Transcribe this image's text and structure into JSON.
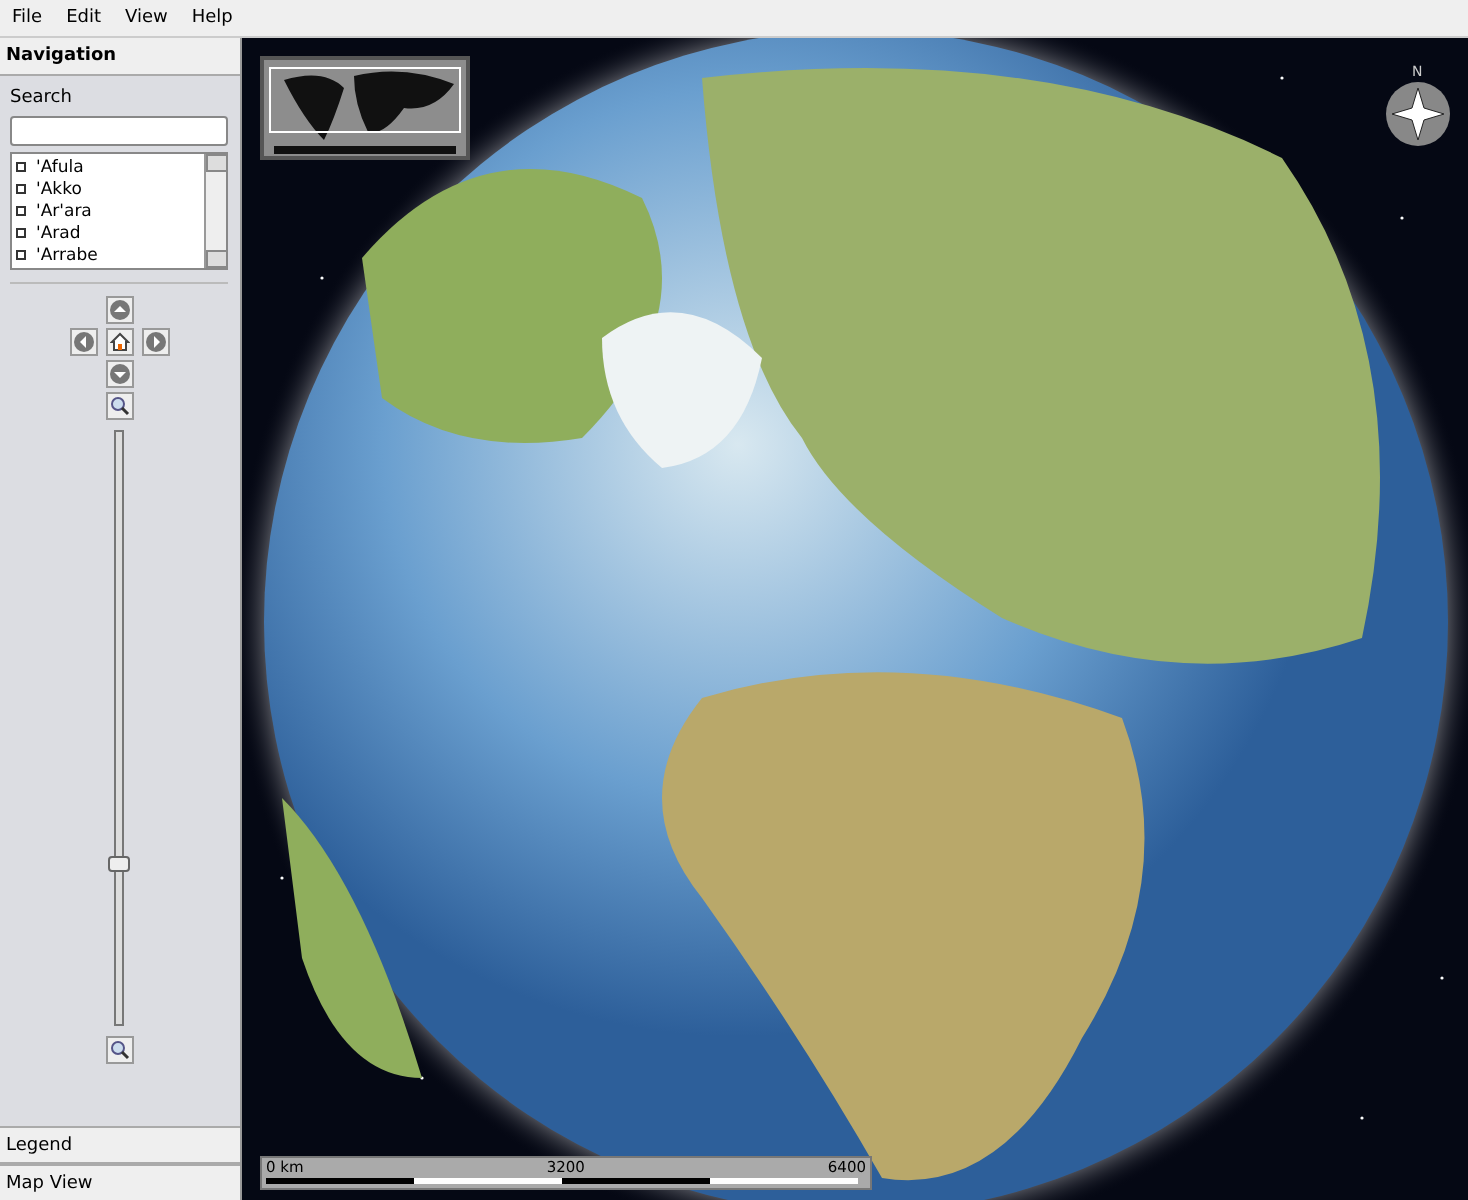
{
  "menu": [
    "File",
    "Edit",
    "View",
    "Help"
  ],
  "navigation": {
    "title": "Navigation",
    "search": {
      "label": "Search"
    },
    "places": [
      "'Afula",
      "'Akko",
      "'Ar'ara",
      "'Arad",
      "'Arrabe"
    ],
    "zoom": {
      "level": 0.27
    }
  },
  "panels": [
    "Legend",
    "Map View"
  ],
  "map": {
    "compass": {
      "label": "N"
    },
    "scale_bar": {
      "ticks": [
        "0 km",
        "3200",
        "6400"
      ]
    }
  }
}
